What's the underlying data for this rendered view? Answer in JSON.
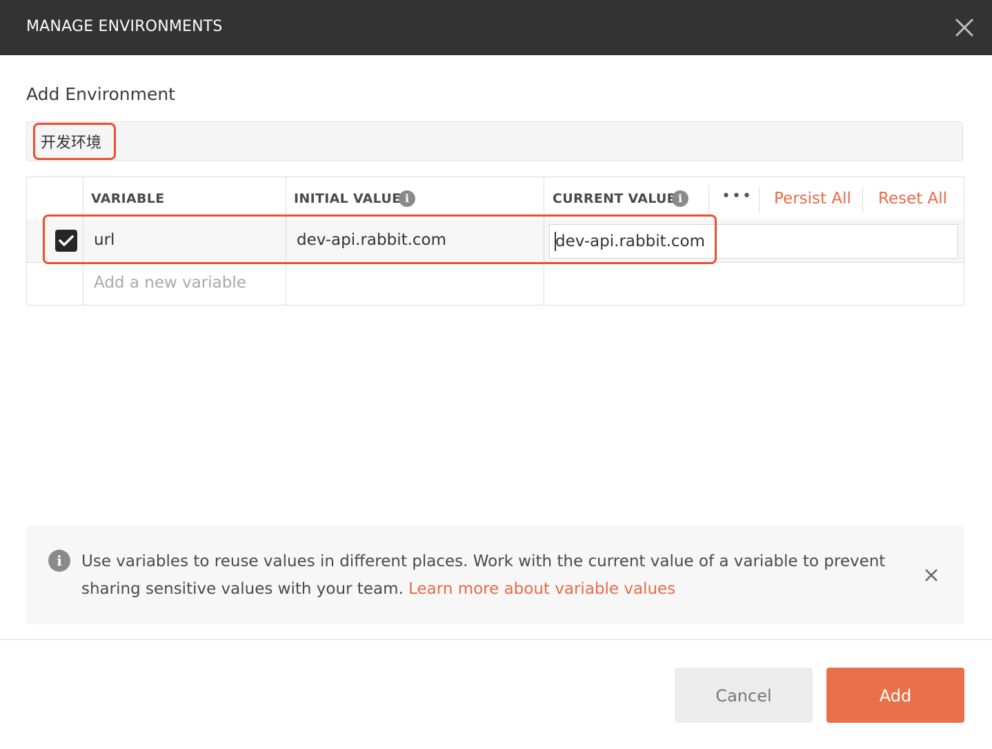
{
  "header": {
    "title": "MANAGE ENVIRONMENTS"
  },
  "section": {
    "heading": "Add Environment"
  },
  "env": {
    "name": "开发环境"
  },
  "table": {
    "columns": [
      "VARIABLE",
      "INITIAL VALUE",
      "CURRENT VALUE"
    ],
    "more_label": "•••",
    "persist_all": "Persist All",
    "reset_all": "Reset All",
    "rows": [
      {
        "checked": true,
        "variable": "url",
        "initial_value": "dev-api.rabbit.com",
        "current_value": "dev-api.rabbit.com"
      }
    ],
    "new_placeholder": "Add a new variable"
  },
  "notice": {
    "text": "Use variables to reuse values in different places. Work with the current value of a variable to prevent sharing sensitive values with your team.",
    "link": "Learn more about variable values"
  },
  "footer": {
    "cancel": "Cancel",
    "add": "Add"
  },
  "colors": {
    "accent": "#e86a45",
    "highlight": "#e8502f",
    "titlebar": "#333333"
  }
}
